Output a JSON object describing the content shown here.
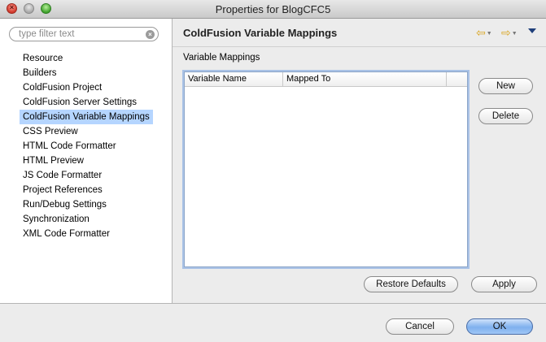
{
  "window": {
    "title": "Properties for BlogCFC5"
  },
  "filter": {
    "placeholder": "type filter text"
  },
  "tree": {
    "items": [
      {
        "label": "Resource",
        "selected": false
      },
      {
        "label": "Builders",
        "selected": false
      },
      {
        "label": "ColdFusion Project",
        "selected": false
      },
      {
        "label": "ColdFusion Server Settings",
        "selected": false
      },
      {
        "label": "ColdFusion Variable Mappings",
        "selected": true
      },
      {
        "label": "CSS Preview",
        "selected": false
      },
      {
        "label": "HTML Code Formatter",
        "selected": false
      },
      {
        "label": "HTML Preview",
        "selected": false
      },
      {
        "label": "JS Code Formatter",
        "selected": false
      },
      {
        "label": "Project References",
        "selected": false
      },
      {
        "label": "Run/Debug Settings",
        "selected": false
      },
      {
        "label": "Synchronization",
        "selected": false
      },
      {
        "label": "XML Code Formatter",
        "selected": false
      }
    ]
  },
  "page": {
    "title": "ColdFusion Variable Mappings",
    "section_label": "Variable Mappings",
    "table": {
      "columns": [
        "Variable Name",
        "Mapped To",
        ""
      ],
      "rows": []
    },
    "buttons": {
      "new": "New",
      "delete": "Delete",
      "restore_defaults": "Restore Defaults",
      "apply": "Apply"
    }
  },
  "footer": {
    "cancel": "Cancel",
    "ok": "OK"
  },
  "icons": {
    "back": "arrow-left-icon",
    "forward": "arrow-right-icon",
    "view_menu": "chevron-down-icon",
    "clear": "clear-icon"
  },
  "colors": {
    "selection": "#b5d5ff",
    "nav_arrow": "#d9a520",
    "default_button": "#7fb0ee"
  }
}
